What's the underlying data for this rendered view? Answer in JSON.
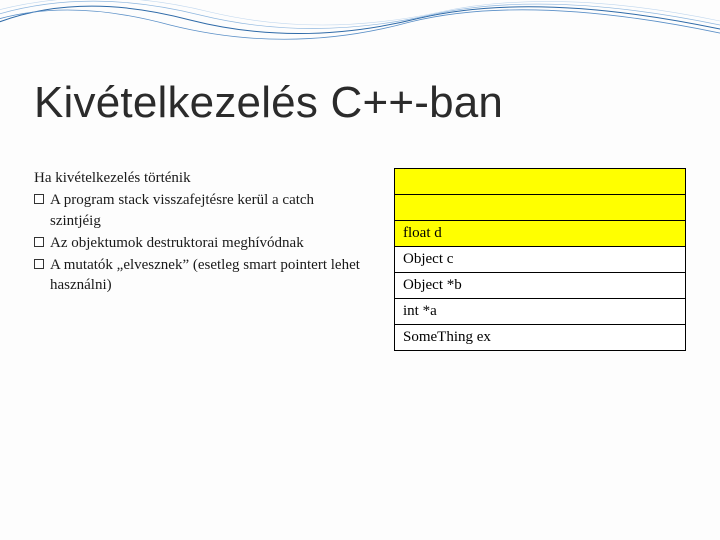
{
  "title": "Kivételkezelés C++-ban",
  "left": {
    "lead": "Ha kivételkezelés történik",
    "b1": "A program stack visszafejtésre kerül a catch szintjéig",
    "b2": "Az objektumok destruktorai meghívódnak",
    "b3": "A mutatók „elvesznek” (esetleg smart pointert lehet használni)"
  },
  "stack": {
    "r0": "",
    "r1": "",
    "r2": "float d",
    "r3": "Object c",
    "r4": "Object *b",
    "r5": "int *a",
    "r6": "SomeThing ex"
  }
}
